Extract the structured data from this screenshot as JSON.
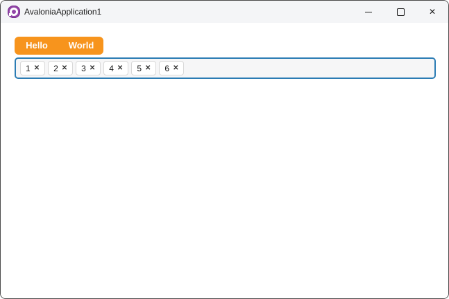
{
  "window": {
    "title": "AvaloniaApplication1",
    "icons": {
      "app_logo": "avalonia-logo",
      "minimize": "minimize-icon",
      "maximize": "maximize-icon",
      "close": "close-icon"
    },
    "close_glyph": "✕"
  },
  "tab_strip": {
    "tabs": [
      {
        "label": "Hello"
      },
      {
        "label": "World"
      }
    ]
  },
  "tag_input": {
    "chips": [
      {
        "label": "1"
      },
      {
        "label": "2"
      },
      {
        "label": "3"
      },
      {
        "label": "4"
      },
      {
        "label": "5"
      },
      {
        "label": "6"
      }
    ],
    "remove_glyph": "✕"
  },
  "colors": {
    "accent_orange": "#F7941D",
    "focus_border_blue": "#2B7CB4",
    "logo_purple": "#9246A8",
    "titlebar_bg": "#F4F5F7",
    "window_border": "#4A4A4A"
  }
}
